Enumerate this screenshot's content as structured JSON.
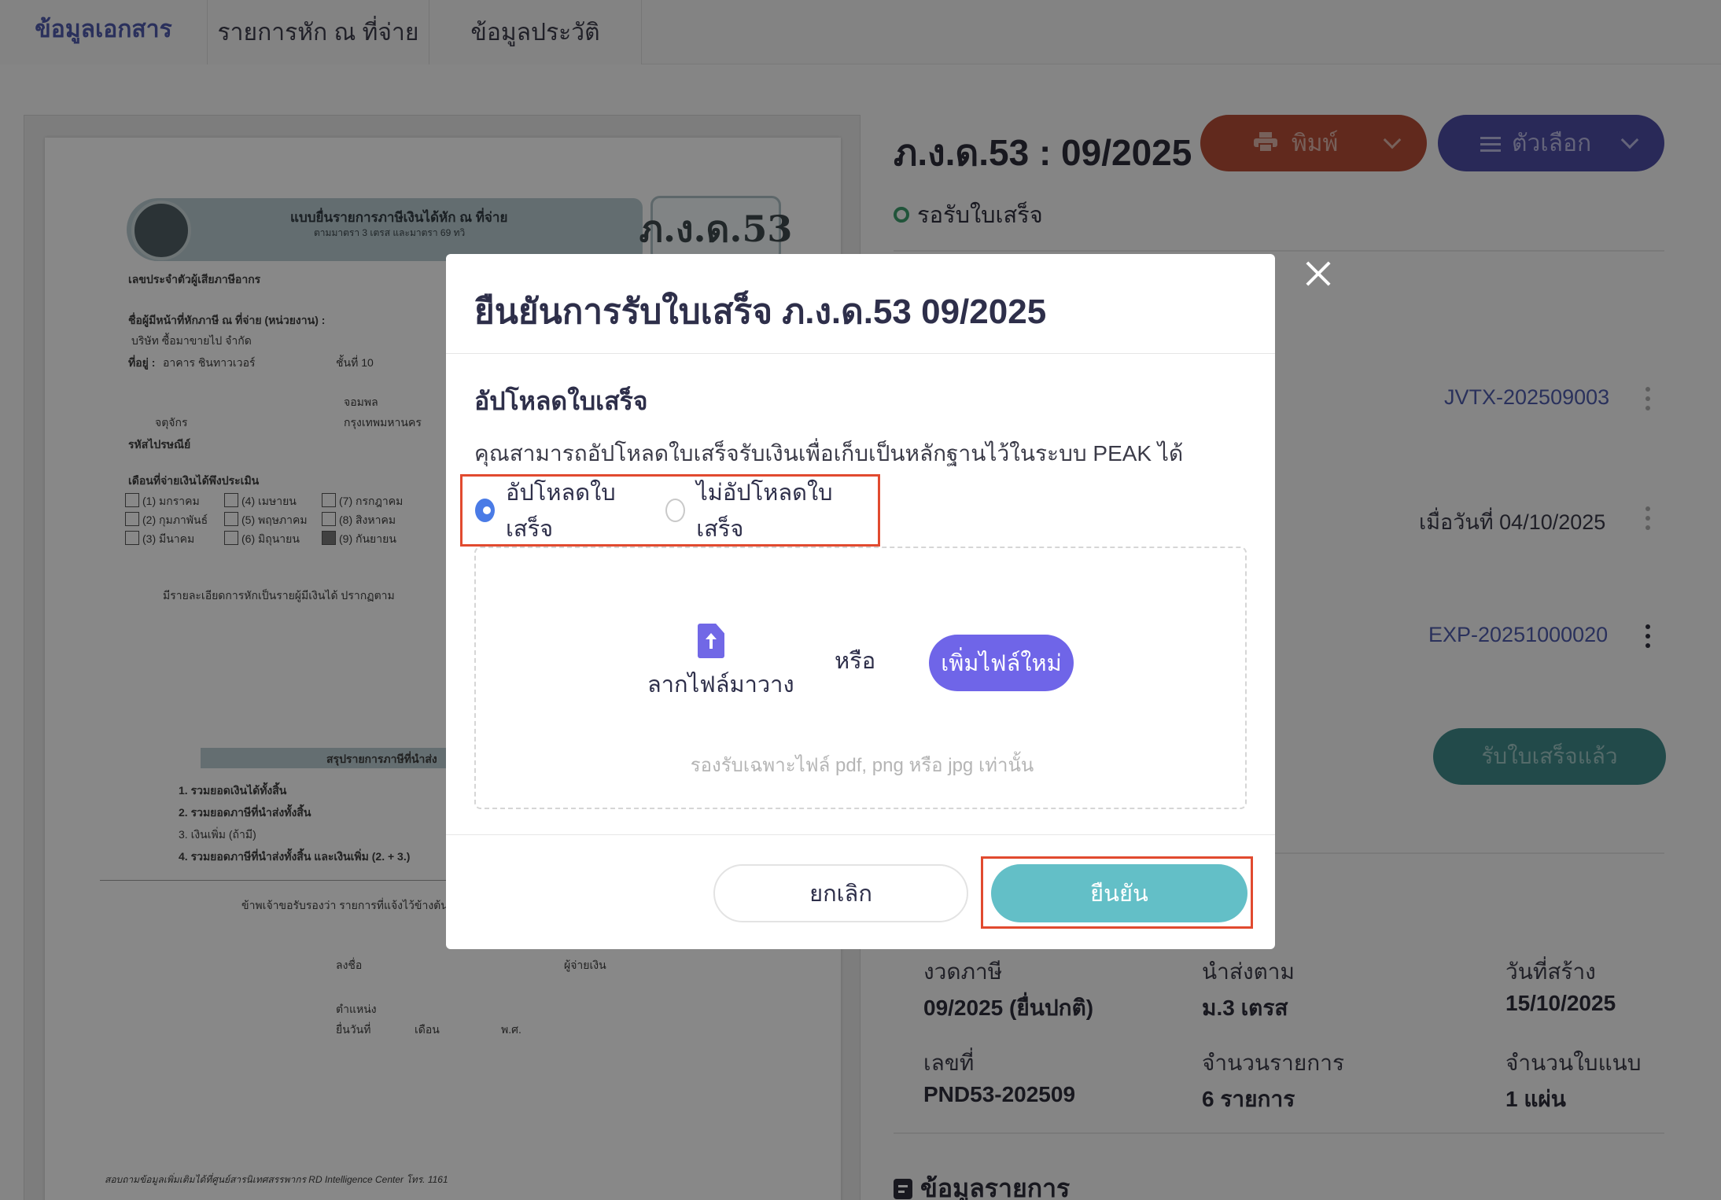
{
  "tabs": [
    {
      "label": "ข้อมูลเอกสาร"
    },
    {
      "label": "รายการหัก ณ ที่จ่าย"
    },
    {
      "label": "ข้อมูลประวัติ"
    }
  ],
  "document": {
    "heading": "ภ.ง.ด.53 : 09/2025",
    "status": "รอรับใบเสร็จ",
    "print_label": "พิมพ์",
    "options_label": "ตัวเลือก",
    "refs": [
      {
        "text": "JVTX-202509003"
      },
      {
        "text": "เมื่อวันที่ 04/10/2025"
      },
      {
        "text": "EXP-20251000020"
      }
    ],
    "received_label": "รับใบเสร็จแล้ว",
    "info": {
      "period_label": "งวดภาษี",
      "period_value": "09/2025 (ยื่นปกติ)",
      "by_label": "นำส่งตาม",
      "by_value": "ม.3 เตรส",
      "created_label": "วันที่สร้าง",
      "created_value": "15/10/2025",
      "no_label": "เลขที่",
      "no_value": "PND53-202509",
      "count_label": "จำนวนรายการ",
      "count_value": "6 รายการ",
      "attach_label": "จำนวนใบแนบ",
      "attach_value": "1 แผ่น"
    },
    "section_title": "ข้อมูลรายการ"
  },
  "form": {
    "code": "ภ.ง.ด.53",
    "title": "แบบยื่นรายการภาษีเงินได้หัก ณ ที่จ่าย",
    "subtitle": "ตามมาตรา 3 เตรส และมาตรา 69 ทวิ",
    "tax_id_label": "เลขประจำตัวผู้เสียภาษีอากร",
    "payer_label": "ชื่อผู้มีหน้าที่หักภาษี ณ ที่จ่าย (หน่วยงาน) :",
    "company": "บริษัท ซื้อมาขายไป จำกัด",
    "address_label": "ที่อยู่ :",
    "building": "อาคาร ชินทาวเวอร์",
    "floor": "ชั้นที่ 10",
    "subdistrict": "จอมพล",
    "district": "จตุจักร",
    "province": "กรุงเทพมหานคร",
    "postal_label": "รหัสไปรษณีย์",
    "month_label": "เดือนที่จ่ายเงินได้พึงประเมิน",
    "months": [
      "(1) มกราคม",
      "(2) กุมภาพันธ์",
      "(3) มีนาคม",
      "(4) เมษายน",
      "(5) พฤษภาคม",
      "(6) มิถุนายน",
      "(7) กรกฎาคม",
      "(8) สิงหาคม",
      "(9) กันยายน"
    ],
    "detail_text": "มีรายละเอียดการหักเป็นรายผู้มีเงินได้ ปรากฏตาม",
    "summary_title": "สรุปรายการภาษีที่นำส่ง",
    "summary_lines": [
      "1. รวมยอดเงินได้ทั้งสิ้น",
      "2. รวมยอดภาษีที่นำส่งทั้งสิ้น",
      "3. เงินเพิ่ม (ถ้ามี)",
      "4. รวมยอดภาษีที่นำส่งทั้งสิ้น และเงินเพิ่ม (2. + 3.)"
    ],
    "certify": "ข้าพเจ้าขอรับรองว่า รายการที่แจ้งไว้ข้างต้น",
    "sign": "ลงชื่อ",
    "payer": "ผู้จ่ายเงิน",
    "position": "ตำแหน่ง",
    "filed": "ยื่นวันที่",
    "month": "เดือน",
    "year": "พ.ศ.",
    "footer": "สอบถามข้อมูลเพิ่มเติมได้ที่ศูนย์สารนิเทศสรรพากร RD Intelligence Center โทร. 1161"
  },
  "modal": {
    "title": "ยืนยันการรับใบเสร็จ ภ.ง.ด.53 09/2025",
    "subtitle": "อัปโหลดใบเสร็จ",
    "description": "คุณสามารถอัปโหลดใบเสร็จรับเงินเพื่อเก็บเป็นหลักฐานไว้ในระบบ PEAK ได้",
    "radio_upload": "อัปโหลดใบเสร็จ",
    "radio_no_upload": "ไม่อัปโหลดใบเสร็จ",
    "selected": "upload",
    "drop_label": "ลากไฟล์มาวาง",
    "or_label": "หรือ",
    "add_file": "เพิ่มไฟล์ใหม่",
    "hint": "รองรับเฉพาะไฟล์ pdf, png หรือ jpg เท่านั้น",
    "cancel": "ยกเลิก",
    "confirm": "ยืนยัน"
  },
  "colors": {
    "accent": "#6f65e8",
    "confirm": "#63bfc7",
    "highlight": "#e14a2f",
    "radio": "#4a7be6"
  },
  "icons": [
    "printer-icon",
    "menu-icon",
    "chevron-down-icon",
    "file-upload-icon",
    "close-icon",
    "document-list-icon"
  ]
}
